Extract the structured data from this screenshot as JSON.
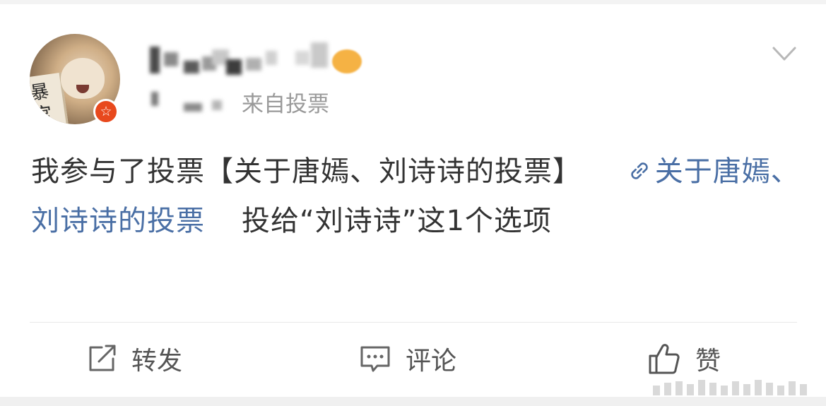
{
  "post": {
    "source_label": "来自投票",
    "body_prefix": "我参与了投票【关于唐嫣、刘诗诗的投票】",
    "link_label": "关于唐嫣、刘诗诗的投票",
    "body_suffix": "投给“刘诗诗”这1个选项"
  },
  "avatar": {
    "scroll_text": "暴宫"
  },
  "actions": {
    "repost_label": "转发",
    "comment_label": "评论",
    "like_label": "赞"
  },
  "icons": {
    "badge": "star-badge-icon",
    "menu": "chevron-down-icon",
    "link": "link-icon",
    "repost": "repost-icon",
    "comment": "comment-icon",
    "like": "thumbs-up-icon"
  },
  "colors": {
    "link": "#4a6fa5",
    "badge": "#e8491d",
    "muted": "#9a9a9a"
  }
}
